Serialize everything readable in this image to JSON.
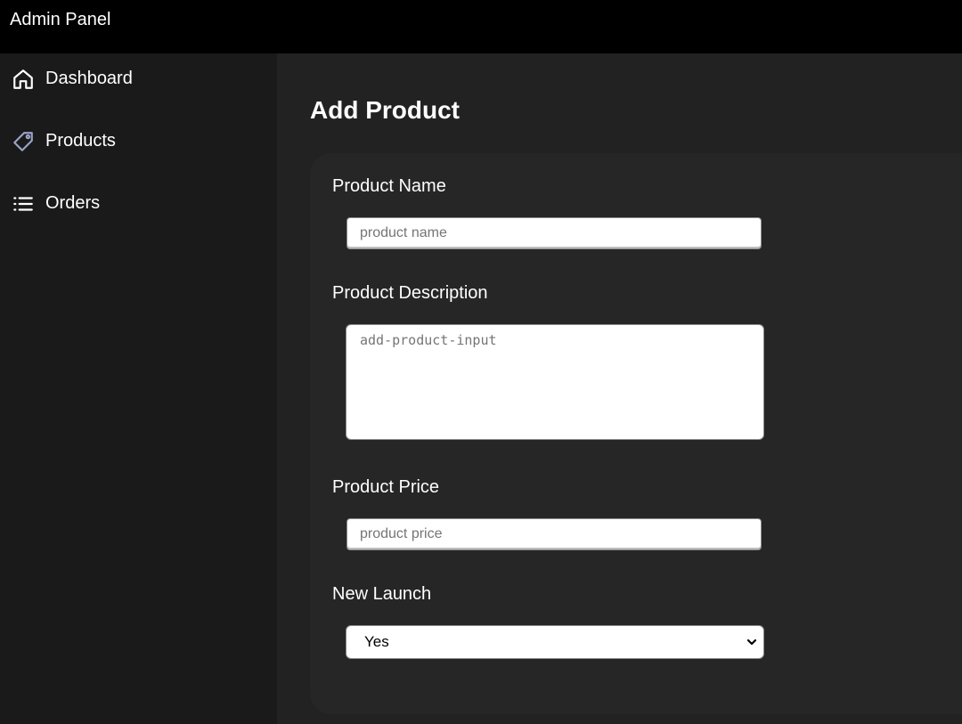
{
  "app": {
    "title": "Admin Panel"
  },
  "sidebar": {
    "items": [
      {
        "label": "Dashboard",
        "icon": "home-icon"
      },
      {
        "label": "Products",
        "icon": "tag-icon"
      },
      {
        "label": "Orders",
        "icon": "list-icon"
      }
    ]
  },
  "main": {
    "title": "Add Product",
    "form": {
      "name_label": "Product Name",
      "name_placeholder": "product name",
      "name_value": "",
      "description_label": "Product Description",
      "description_placeholder": "add-product-input",
      "description_value": "",
      "price_label": "Product Price",
      "price_placeholder": "product price",
      "price_value": "",
      "launch_label": "New Launch",
      "launch_selected": "Yes"
    }
  },
  "colors": {
    "topbar": "#000000",
    "sidebar": "#1a1a1a",
    "main": "#222222",
    "card": "#262626",
    "text": "#ffffff",
    "tag_icon": "#9aa3c7"
  }
}
